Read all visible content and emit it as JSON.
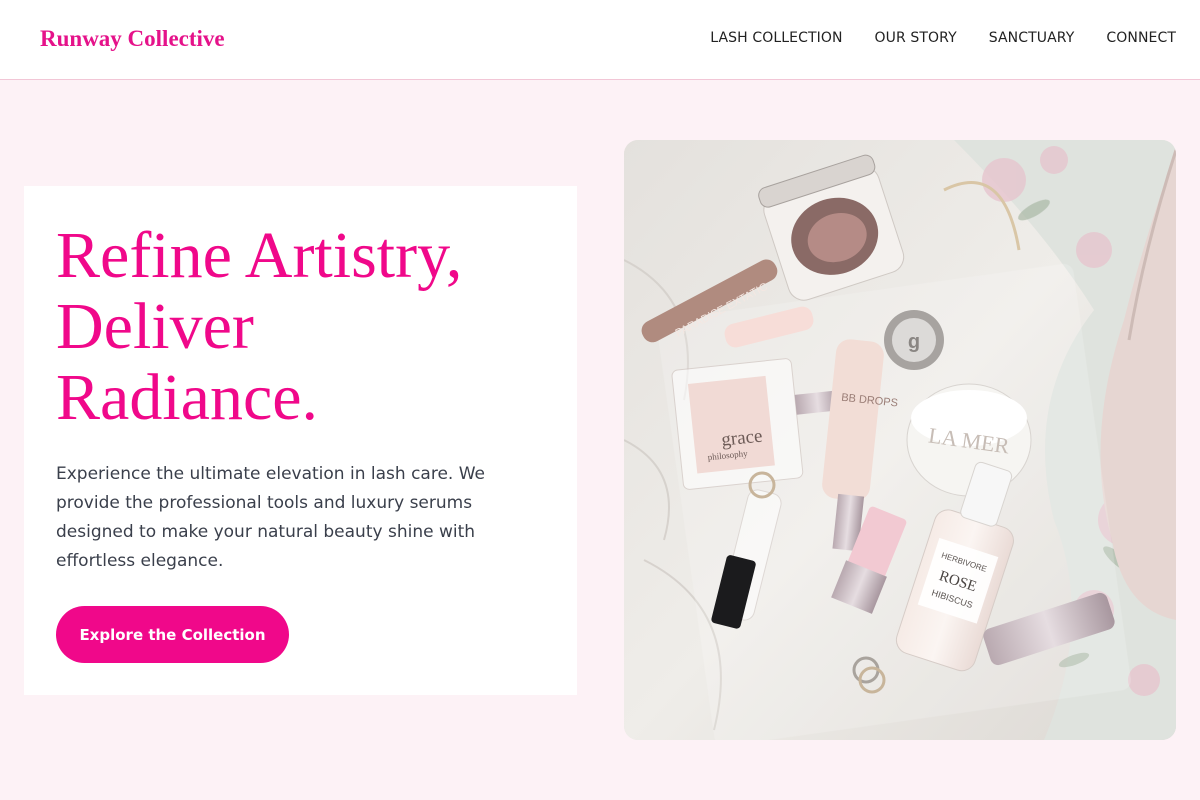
{
  "header": {
    "brand": "Runway Collective",
    "nav": [
      "LASH COLLECTION",
      "OUR STORY",
      "SANCTUARY",
      "CONNECT"
    ]
  },
  "hero": {
    "title_lines": [
      "Refine Artistry,",
      "Deliver",
      "Radiance."
    ],
    "description": "Experience the ultimate elevation in lash care. We provide the professional tools and luxury serums designed to make your natural beauty shine with effortless elegance.",
    "cta_label": "Explore the Collection"
  },
  "image": {
    "subject": "flat-lay-cosmetics-photo",
    "labels": {
      "palette_brand": "PARADISE EXTATIC",
      "perfume_brand": "philosophy",
      "perfume_name": "grace",
      "tube_label": "BB DROPS",
      "jar_brand": "LA MER",
      "serum_brand": "HERBIVORE",
      "serum_name_1": "ROSE",
      "serum_name_2": "HIBISCUS",
      "logo_mark": "g"
    }
  },
  "colors": {
    "accent": "#f0088a",
    "brand": "#e5128a",
    "page_bg": "#fdf2f6",
    "body_text": "#3a3f4b"
  }
}
